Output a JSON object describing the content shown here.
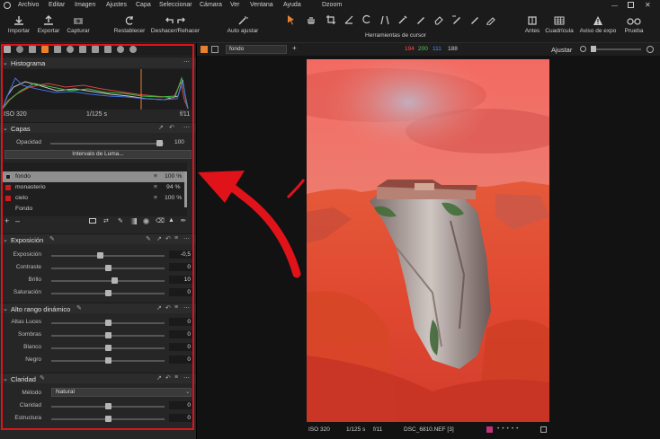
{
  "menubar": {
    "items": [
      "Archivo",
      "Editar",
      "Imagen",
      "Ajustes",
      "Capa",
      "Seleccionar",
      "Cámara",
      "Ver",
      "Ventana",
      "Ayuda"
    ],
    "window_title": "Dzoom"
  },
  "toolbar": {
    "import_label": "Importar",
    "export_label": "Exportar",
    "capture_label": "Capturar",
    "reset_label": "Restablecer",
    "undo_redo_label": "Deshacer/Rehacer",
    "auto_adjust_label": "Auto ajustar",
    "cursor_tools_label": "Herramientas de cursor",
    "before_label": "Antes",
    "grid_label": "Cuadrícula",
    "exposure_warning_label": "Aviso de expo",
    "proof_label": "Prueba"
  },
  "histogram": {
    "title": "Histograma",
    "iso": "ISO 320",
    "shutter": "1/125 s",
    "aperture": "f/11"
  },
  "layers": {
    "title": "Capas",
    "opacity_label": "Opacidad",
    "opacity_value": "100",
    "luma_button": "Intervalo de Luma...",
    "items": [
      {
        "name": "fondo",
        "value": "100 %"
      },
      {
        "name": "monasterio",
        "value": "94 %"
      },
      {
        "name": "cielo",
        "value": "100 %"
      },
      {
        "name": "Fondo",
        "value": ""
      }
    ]
  },
  "exposure": {
    "title": "Exposición",
    "rows": [
      {
        "label": "Exposición",
        "value": "-0,5",
        "pos": 0.43
      },
      {
        "label": "Contraste",
        "value": "0",
        "pos": 0.5
      },
      {
        "label": "Brillo",
        "value": "10",
        "pos": 0.56
      },
      {
        "label": "Saturación",
        "value": "0",
        "pos": 0.5
      }
    ]
  },
  "hdr": {
    "title": "Alto rango dinámico",
    "rows": [
      {
        "label": "Altas Luces",
        "value": "0",
        "pos": 0.5
      },
      {
        "label": "Sombras",
        "value": "0",
        "pos": 0.5
      },
      {
        "label": "Blanco",
        "value": "0",
        "pos": 0.5
      },
      {
        "label": "Negro",
        "value": "0",
        "pos": 0.5
      }
    ]
  },
  "clarity": {
    "title": "Claridad",
    "method_label": "Método",
    "method_value": "Natural",
    "rows": [
      {
        "label": "Claridad",
        "value": "0",
        "pos": 0.5
      },
      {
        "label": "Estructura",
        "value": "0",
        "pos": 0.5
      }
    ]
  },
  "viewer": {
    "layer_select": "fondo",
    "rgb_r": "194",
    "rgb_g": "200",
    "rgb_b": "111",
    "rgb_l": "188",
    "adjust_label": "Ajustar",
    "footer_iso": "ISO 320",
    "footer_shutter": "1/125 s",
    "footer_aperture": "f/11",
    "footer_file": "DSC_6810.NEF [3]"
  },
  "colors": {
    "annotation": "#e0131b",
    "accent": "#e8812f",
    "red": "#ff4b4b",
    "green": "#4fd24f",
    "blue": "#4f8cff"
  }
}
